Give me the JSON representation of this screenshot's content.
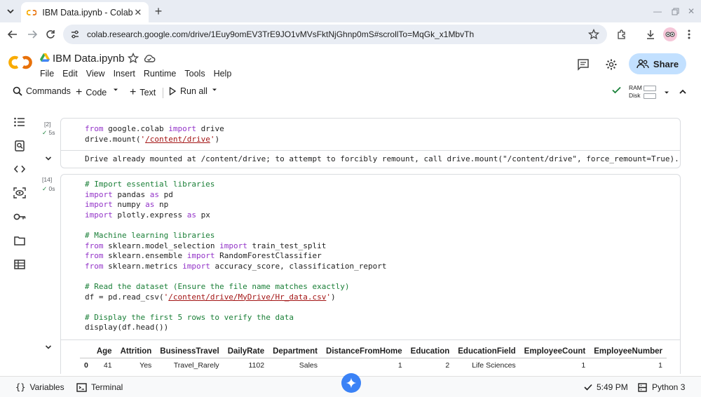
{
  "browser": {
    "tab_title": "IBM Data.ipynb - Colab",
    "url": "colab.research.google.com/drive/1Euy9omEV3TrE9JO1vMVsFktNjGhnp0mS#scrollTo=MqGk_x1MbvTh"
  },
  "notebook": {
    "title": "IBM Data.ipynb",
    "menu": [
      "File",
      "Edit",
      "View",
      "Insert",
      "Runtime",
      "Tools",
      "Help"
    ],
    "share_label": "Share"
  },
  "commands": {
    "commands_label": "Commands",
    "code_label": "Code",
    "text_label": "Text",
    "run_all_label": "Run all",
    "ram_label": "RAM",
    "disk_label": "Disk"
  },
  "cells": [
    {
      "exec_count": "[2]",
      "duration": "5s",
      "output": "Drive already mounted at /content/drive; to attempt to forcibly remount, call drive.mount(\"/content/drive\", force_remount=True)."
    },
    {
      "exec_count": "[14]",
      "duration": "0s"
    }
  ],
  "dataframe": {
    "columns": [
      "",
      "Age",
      "Attrition",
      "BusinessTravel",
      "DailyRate",
      "Department",
      "DistanceFromHome",
      "Education",
      "EducationField",
      "EmployeeCount",
      "EmployeeNumber"
    ],
    "row": [
      "0",
      "41",
      "Yes",
      "Travel_Rarely",
      "1102",
      "Sales",
      "1",
      "2",
      "Life Sciences",
      "1",
      "1"
    ]
  },
  "statusbar": {
    "variables_label": "Variables",
    "terminal_label": "Terminal",
    "time": "5:49 PM",
    "runtime": "Python 3"
  }
}
